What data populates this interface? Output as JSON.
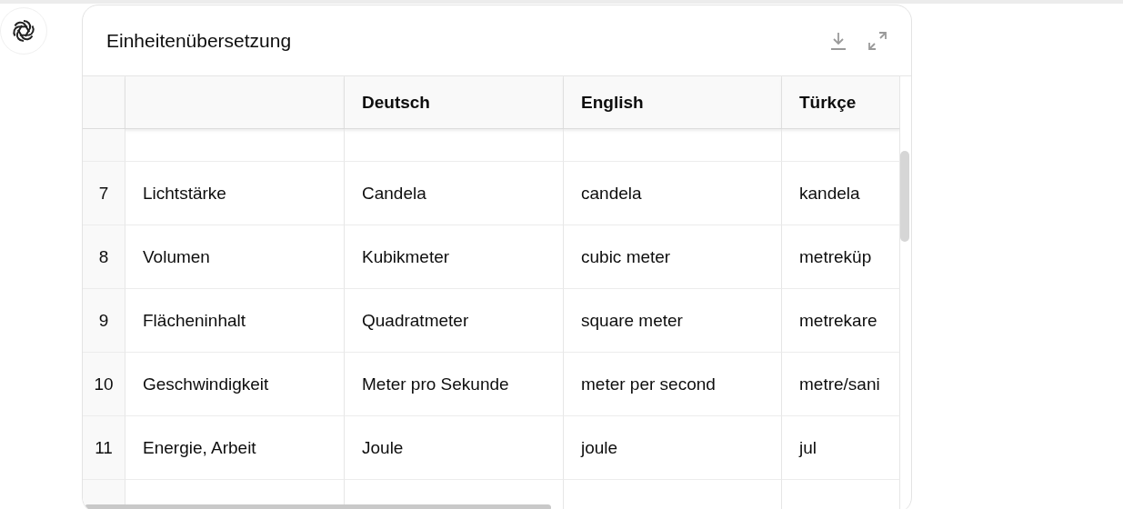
{
  "card": {
    "title": "Einheitenübersetzung"
  },
  "table": {
    "columns": [
      "",
      "Deutsch",
      "English",
      "Türkçe"
    ],
    "rows": [
      {
        "index": "7",
        "cells": [
          "Lichtstärke",
          "Candela",
          "candela",
          "kandela"
        ]
      },
      {
        "index": "8",
        "cells": [
          "Volumen",
          "Kubikmeter",
          "cubic meter",
          "metreküp"
        ]
      },
      {
        "index": "9",
        "cells": [
          "Flächeninhalt",
          "Quadratmeter",
          "square meter",
          "metrekare"
        ]
      },
      {
        "index": "10",
        "cells": [
          "Geschwindigkeit",
          "Meter pro Sekunde",
          "meter per second",
          "metre/sani"
        ]
      },
      {
        "index": "11",
        "cells": [
          "Energie, Arbeit",
          "Joule",
          "joule",
          "jul"
        ]
      }
    ]
  }
}
